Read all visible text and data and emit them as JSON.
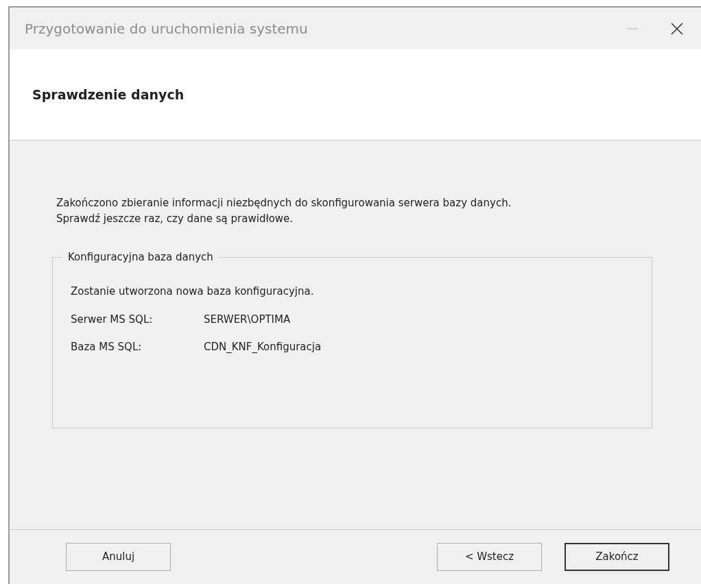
{
  "window": {
    "title": "Przygotowanie do uruchomienia systemu",
    "minimize_disabled": true
  },
  "header": {
    "title": "Sprawdzenie danych"
  },
  "intro": [
    "Zakończono zbieranie informacji niezbędnych do skonfigurowania serwera bazy danych.",
    "Sprawdź jeszcze raz, czy dane są prawidłowe."
  ],
  "group": {
    "legend": "Konfiguracyjna baza danych",
    "message": "Zostanie utworzona nowa baza konfiguracyjna.",
    "fields": [
      {
        "label": "Serwer MS SQL:",
        "value": "SERWER\\OPTIMA"
      },
      {
        "label": "Baza MS SQL:",
        "value": "CDN_KNF_Konfiguracja"
      }
    ]
  },
  "buttons": [
    {
      "label": "Anuluj",
      "default": false,
      "kind": "cancel"
    },
    {
      "label": "< Wstecz",
      "default": false,
      "kind": "nav"
    },
    {
      "label": "Zakończ",
      "default": true,
      "kind": "nav"
    }
  ]
}
